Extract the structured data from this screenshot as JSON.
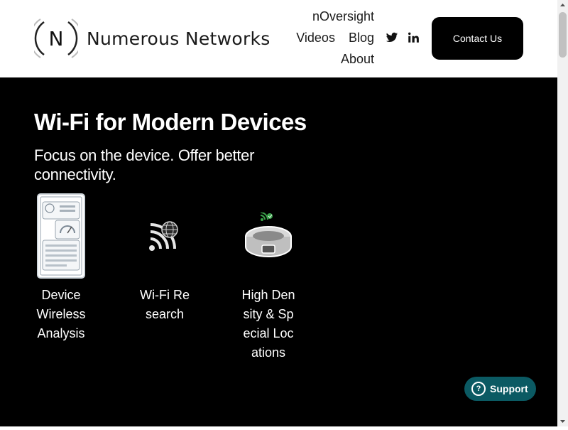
{
  "header": {
    "logo_text": "Numerous Networks",
    "logo_letter": "N",
    "nav": {
      "row1": [
        {
          "label": "nOversight"
        }
      ],
      "row2": [
        {
          "label": "Videos"
        },
        {
          "label": "Blog"
        }
      ],
      "row3": [
        {
          "label": "About"
        }
      ]
    },
    "social_icons": [
      "twitter-icon",
      "linkedin-icon"
    ],
    "contact_label": "Contact Us"
  },
  "hero": {
    "title": "Wi-Fi for Modern Devices",
    "subtitle": "Focus on the device. Offer better connectivity.",
    "features": [
      {
        "label": "Device Wireless Analysis",
        "icon": "device-analysis-icon"
      },
      {
        "label": "Wi-Fi Research",
        "icon": "wifi-research-icon"
      },
      {
        "label": "High Density & Special Locations",
        "icon": "stadium-icon"
      }
    ]
  },
  "support": {
    "label": "Support",
    "icon_glyph": "?"
  },
  "colors": {
    "hero_background": "#000000",
    "header_background": "#ffffff",
    "support_background": "#0b5a63",
    "accent_green": "#3aa14a"
  }
}
